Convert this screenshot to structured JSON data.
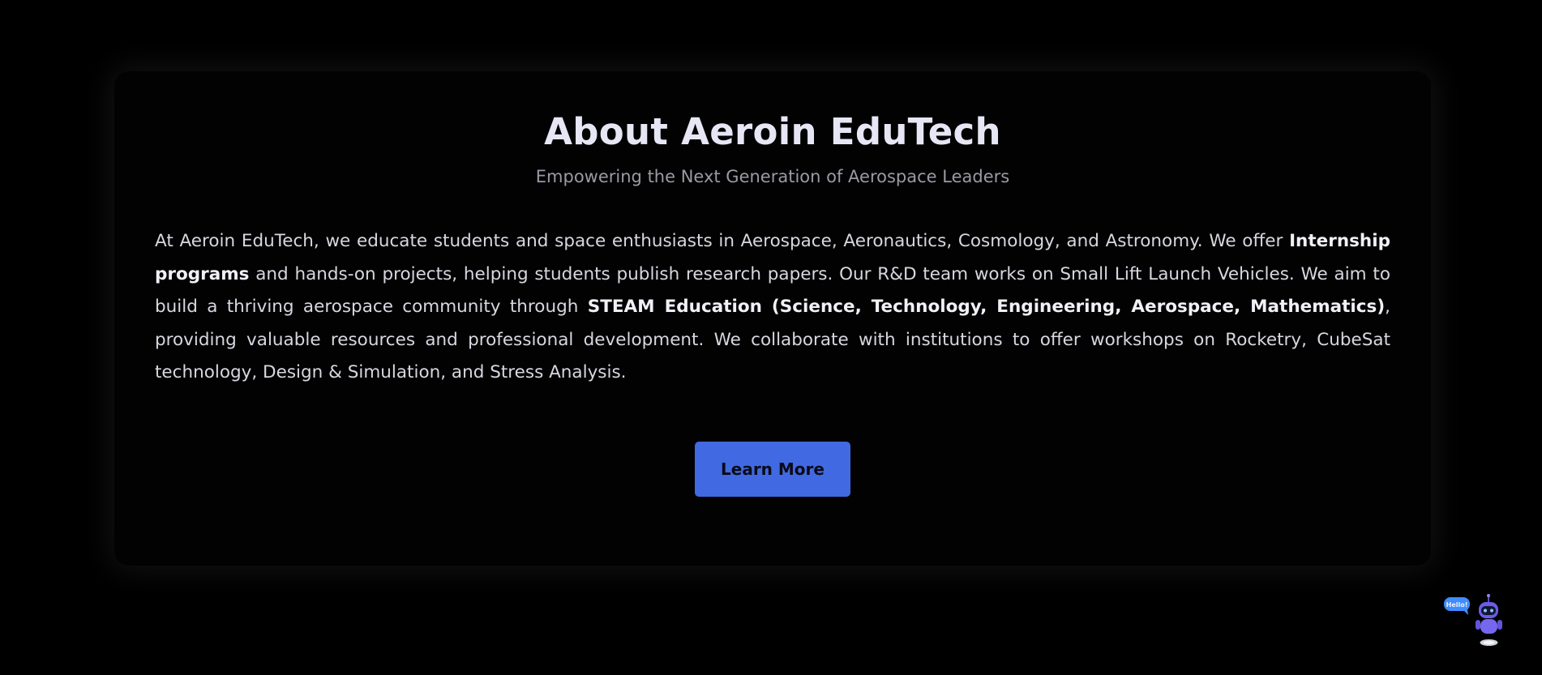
{
  "about": {
    "title": "About Aeroin EduTech",
    "subtitle": "Empowering the Next Generation of Aerospace Leaders",
    "paragraph": [
      {
        "text": "At Aeroin EduTech, we educate students and space enthusiasts in Aerospace, Aeronautics, Cosmology, and Astronomy. We offer ",
        "bold": false
      },
      {
        "text": "Internship programs",
        "bold": true
      },
      {
        "text": " and hands-on projects, helping students publish research papers. Our R&D team works on Small Lift Launch Vehicles. We aim to build a thriving aerospace community through ",
        "bold": false
      },
      {
        "text": "STEAM Education (Science, Technology, Engineering, Aerospace, Mathematics)",
        "bold": true
      },
      {
        "text": ", providing valuable resources and professional development. We collaborate with institutions to offer workshops on Rocketry, CubeSat technology, Design & Simulation, and Stress Analysis.",
        "bold": false
      }
    ],
    "button_label": "Learn More"
  },
  "chatbot": {
    "icon": "robot-chatbot-icon",
    "bubble_text": "Hello!"
  },
  "colors": {
    "background": "#000000",
    "card": "#020203",
    "accent": "#4169e1",
    "title": "#e6e6f5",
    "subtitle": "#9a9aa4",
    "body": "#d7d7df",
    "bot_purple": "#6b5ce7",
    "bubble_blue": "#3f8cff"
  }
}
